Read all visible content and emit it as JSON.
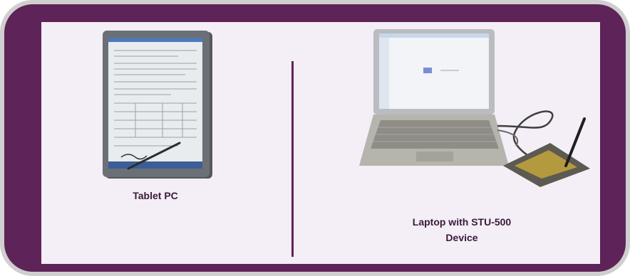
{
  "devices": [
    {
      "caption": "Tablet PC",
      "icon": "tablet-pc-image"
    },
    {
      "caption_lines": [
        "Laptop with STU-500",
        "Device"
      ],
      "icon": "laptop-with-signature-pad-image"
    }
  ],
  "colors": {
    "frame": "#cfcfcf",
    "card": "#5e2358",
    "panel": "#f4eef6",
    "caption": "#3a1a3a"
  }
}
